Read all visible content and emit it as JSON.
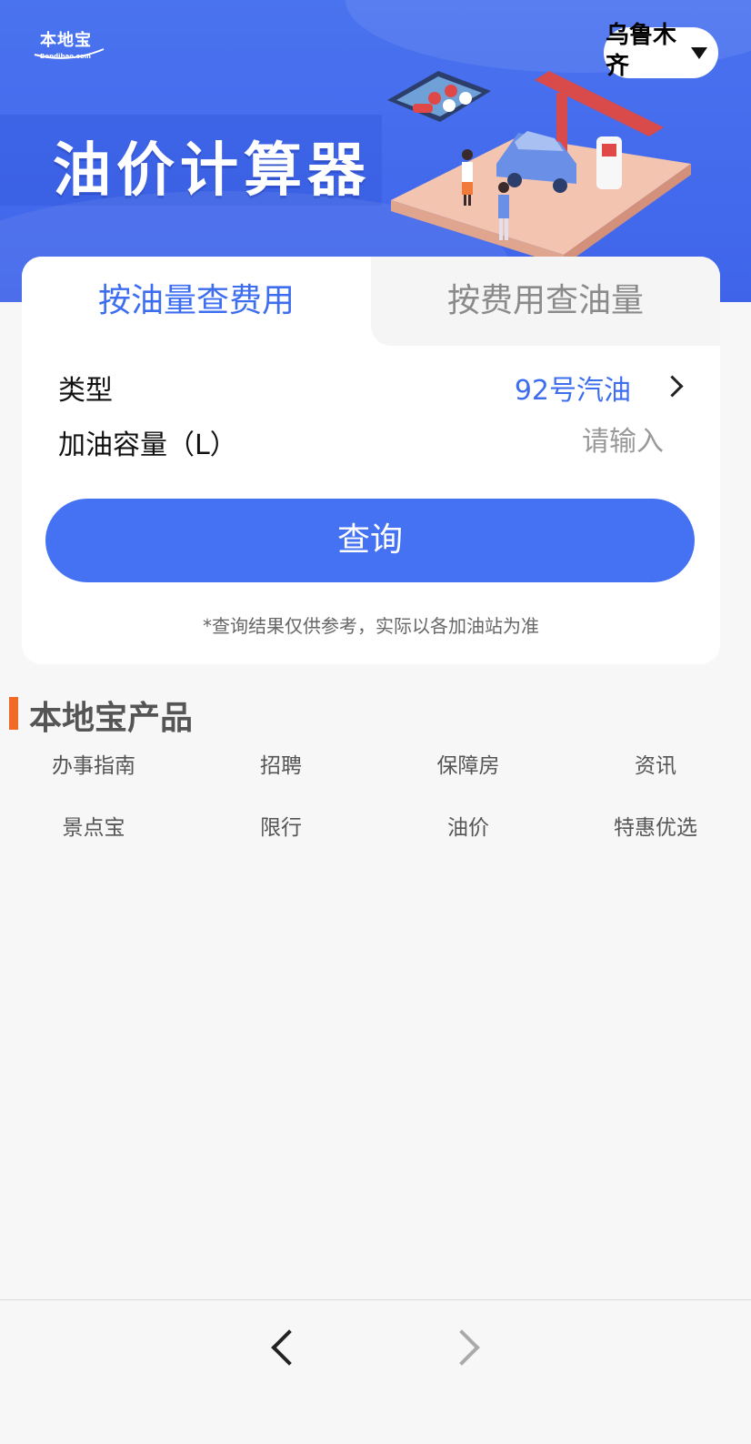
{
  "header": {
    "logo_cn": "本地宝",
    "logo_en": "Bendibao.com",
    "title": "油价计算器",
    "city": "乌鲁木齐"
  },
  "tabs": [
    {
      "label": "按油量查费用",
      "active": true
    },
    {
      "label": "按费用查油量",
      "active": false
    }
  ],
  "form": {
    "type_label": "类型",
    "type_value": "92号汽油",
    "volume_label": "加油容量（L）",
    "volume_placeholder": "请输入",
    "query_button": "查询",
    "disclaimer": "*查询结果仅供参考，实际以各加油站为准"
  },
  "products": {
    "title": "本地宝产品",
    "items": [
      "办事指南",
      "招聘",
      "保障房",
      "资讯",
      "景点宝",
      "限行",
      "油价",
      "特惠优选"
    ]
  },
  "colors": {
    "primary": "#4472f2",
    "accent_bar": "#f06a26",
    "hero": "#4a73ef"
  },
  "icons": {
    "city_dropdown": "caret-down-icon",
    "type_arrow": "chevron-right-icon",
    "nav_back": "chevron-left-icon",
    "nav_forward": "chevron-right-icon"
  }
}
